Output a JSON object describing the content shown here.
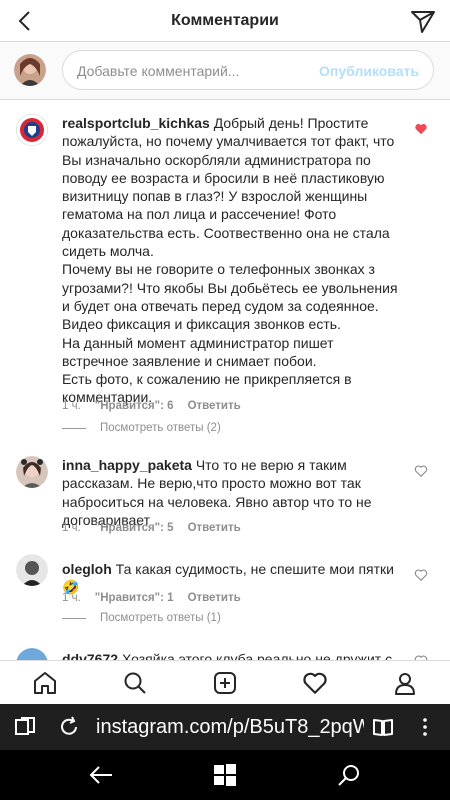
{
  "header": {
    "title": "Комментарии"
  },
  "composer": {
    "placeholder": "Добавьте комментарий...",
    "publish_label": "Опубликовать"
  },
  "comments": [
    {
      "username": "realsportclub_kichkas",
      "text": "Добрый день! Простите пожалуйста, но почему умалчивается тот факт, что Вы изначально оскорбляли администратора по поводу ее возраста и бросили в неё пластиковую визитницу попав в глаз?! У взрослой женщины гематома на пол лица и рассечение! Фото доказательства есть. Соотвественно она не стала сидеть молча.",
      "text2": "Почему вы не говорите о телефонных звонках з угрозами?! Что якобы Вы добьётесь ее увольнения и будет она отвечать перед судом за содеянное.",
      "text3": "Видео фиксация и фиксация звонков есть.",
      "text4": "На данный момент администратор пишет встречное заявление и снимает побои.",
      "text5": "Есть фото, к сожалению не прикрепляется в комментарии.",
      "time": "1 ч.",
      "likes": "\"Нравится\": 6",
      "reply": "Ответить",
      "view_replies": "Посмотреть ответы (2)",
      "liked": true
    },
    {
      "username": "inna_happy_paketa",
      "text": "Что то не верю я таким рассказам. Не верю,что просто можно вот так наброситься на человека. Явно автор что то не договаривает",
      "time": "1 ч.",
      "likes": "\"Нравится\": 5",
      "reply": "Ответить",
      "liked": false
    },
    {
      "username": "olegloh",
      "text": "Та какая судимость, не спешите мои пятки 🤣",
      "time": "1 ч.",
      "likes": "\"Нравится\": 1",
      "reply": "Ответить",
      "view_replies": "Посмотреть ответы (1)",
      "liked": false
    },
    {
      "username": "ddv7672",
      "text": "Хозяйка этого клуба реально не дружит с",
      "liked": false
    }
  ],
  "bottom_nav": [
    "home-icon",
    "search-icon",
    "new-post-icon",
    "activity-icon",
    "profile-icon"
  ],
  "browser": {
    "url": "instagram.com/p/B5uT8_2pqWI"
  },
  "colors": {
    "heart_red": "#ed4956",
    "publish_disabled": "#b2dffc",
    "muted": "#8e8e8e"
  }
}
